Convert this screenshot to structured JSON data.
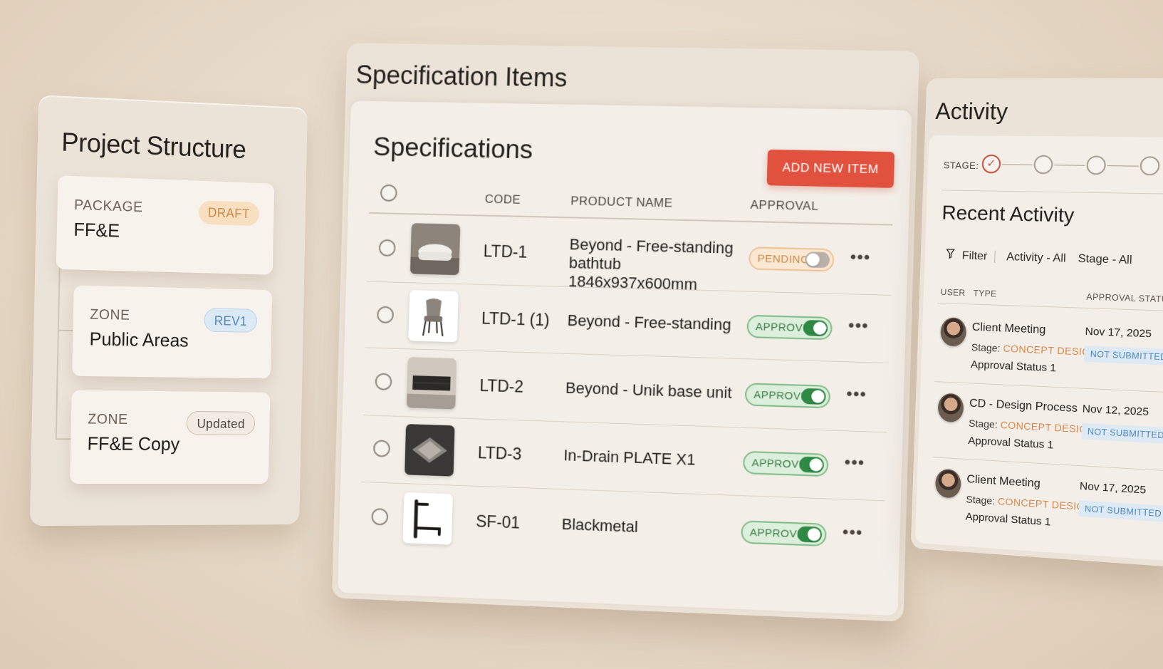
{
  "project_structure": {
    "title": "Project Structure",
    "cards": [
      {
        "kind": "PACKAGE",
        "name": "FF&E",
        "badge": "DRAFT"
      },
      {
        "kind": "ZONE",
        "name": "Public Areas",
        "badge": "REV1"
      },
      {
        "kind": "ZONE",
        "name": "FF&E Copy",
        "badge": "Updated"
      }
    ]
  },
  "specification_items": {
    "outer_title": "Specification Items",
    "heading": "Specifications",
    "add_button": "ADD NEW ITEM",
    "columns": {
      "code": "CODE",
      "product_name": "PRODUCT NAME",
      "approval": "APPROVAL"
    },
    "rows": [
      {
        "code": "LTD-1",
        "product": "Beyond - Free-standing bathtub 1846x937x600mm",
        "approval": "PENDING",
        "toggle": "off",
        "thumb": "bathtub-image",
        "more": "•••"
      },
      {
        "code": "LTD-1 (1)",
        "product": "Beyond - Free-standing",
        "approval": "APPROVED",
        "toggle": "on",
        "thumb": "chair-image",
        "more": "•••"
      },
      {
        "code": "LTD-2",
        "product": "Beyond - Unik base unit",
        "approval": "APPROVED",
        "toggle": "on",
        "thumb": "base-unit-image",
        "more": "•••"
      },
      {
        "code": "LTD-3",
        "product": "In-Drain PLATE X1",
        "approval": "APPROVED",
        "toggle": "on",
        "thumb": "drain-plate-image",
        "more": "•••"
      },
      {
        "code": "SF-01",
        "product": "Blackmetal",
        "approval": "APPROVED",
        "toggle": "on",
        "thumb": "blackmetal-fixture-image",
        "more": "•••"
      }
    ]
  },
  "activity": {
    "title": "Activity",
    "stage_label": "STAGE:",
    "stage_done_mark": "✓",
    "recent_title": "Recent Activity",
    "filter": {
      "icon": "funnel-icon",
      "label": "Filter",
      "activity": "Activity - All",
      "stage": "Stage - All"
    },
    "columns": {
      "user": "USER",
      "type": "TYPE",
      "approval_status": "APPROVAL STATU"
    },
    "rows": [
      {
        "type": "Client Meeting",
        "stage_prefix": "Stage:",
        "stage": "CONCEPT DESIGN",
        "status": "Approval Status 1",
        "date": "Nov 17, 2025",
        "badge": "NOT SUBMITTED"
      },
      {
        "type": "CD - Design Process",
        "stage_prefix": "Stage:",
        "stage": "CONCEPT DESIGN",
        "status": "Approval Status 1",
        "date": "Nov 12, 2025",
        "badge": "NOT SUBMITTED"
      },
      {
        "type": "Client Meeting",
        "stage_prefix": "Stage:",
        "stage": "CONCEPT DESIGN",
        "status": "Approval Status 1",
        "date": "Nov 17, 2025",
        "badge": "NOT SUBMITTED"
      }
    ]
  },
  "colors": {
    "accent_button": "#e0523e",
    "approved_green": "#2e8a43",
    "pending_orange": "#c98a4a",
    "stage_orange": "#d9884a",
    "info_blue": "#4e87b8"
  }
}
